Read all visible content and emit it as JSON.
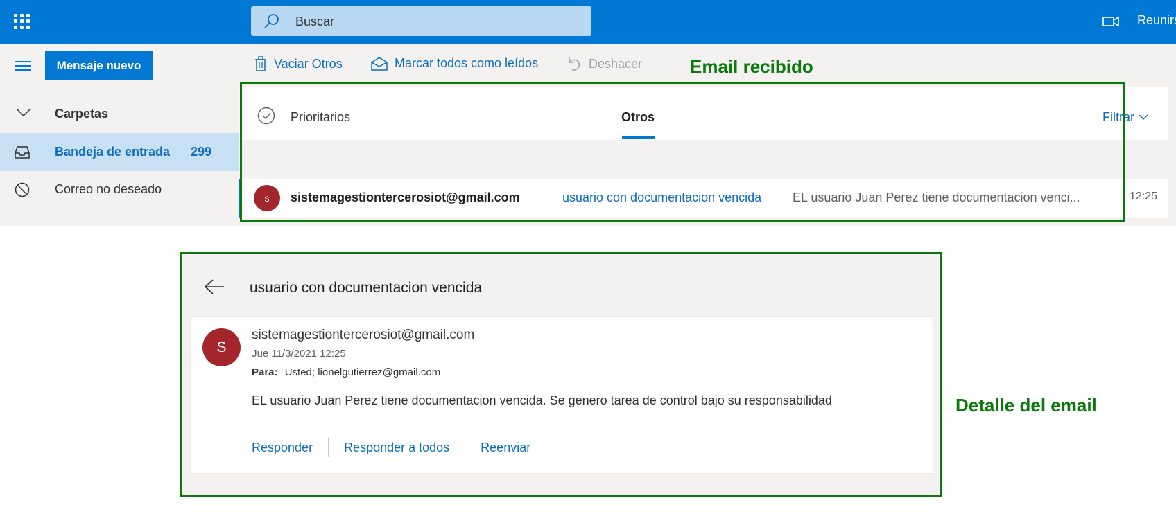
{
  "topbar": {
    "app_launcher_icon": "waffle-icon",
    "search_placeholder": "Buscar",
    "meet_label": "Reunirse"
  },
  "nav": {
    "new_message_label": "Mensaje nuevo",
    "folders_label": "Carpetas",
    "inbox_label": "Bandeja de entrada",
    "inbox_count": "299",
    "junk_label": "Correo no deseado"
  },
  "commands": {
    "empty_label": "Vaciar Otros",
    "mark_read_label": "Marcar todos como leídos",
    "undo_label": "Deshacer"
  },
  "list": {
    "tabs": [
      {
        "label": "Prioritarios",
        "active": false
      },
      {
        "label": "Otros",
        "active": true
      }
    ],
    "filter_label": "Filtrar",
    "messages": [
      {
        "avatar_initial": "s",
        "from": "sistemagestiontercerosiot@gmail.com",
        "subject": "usuario con documentacion vencida",
        "preview": "EL usuario Juan Perez tiene documentacion venci...",
        "time": "12:25"
      }
    ]
  },
  "reading": {
    "subject": "usuario con documentacion vencida",
    "avatar_initial": "S",
    "from": "sistemagestiontercerosiot@gmail.com",
    "date": "Jue 11/3/2021 12:25",
    "to_label": "Para:",
    "to_value": "Usted; lionelgutierrez@gmail.com",
    "body": "EL usuario Juan Perez tiene documentacion vencida. Se genero tarea de control bajo su responsabilidad",
    "actions": [
      "Responder",
      "Responder a todos",
      "Reenviar"
    ]
  },
  "annotations": {
    "received": "Email recibido",
    "detail": "Detalle del email",
    "color": "#0a7a0a"
  },
  "colors": {
    "brand": "#0078d4",
    "avatar": "#a4262c",
    "link": "#0f6cbd"
  }
}
